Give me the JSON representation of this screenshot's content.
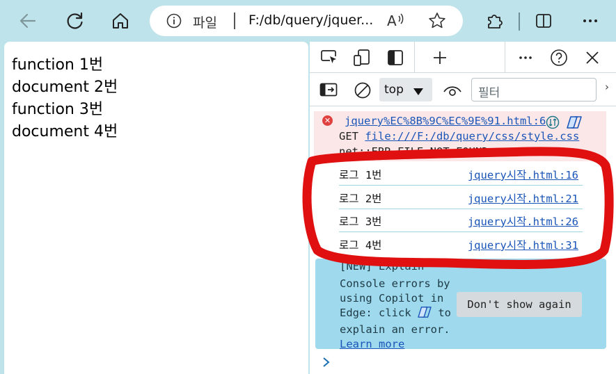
{
  "browser": {
    "site_label": "파일",
    "url": "F:/db/query/jquer...",
    "read_aloud_label": "A"
  },
  "page": {
    "lines": [
      "function 1번",
      "document 2번",
      "function 3번",
      "document 4번"
    ]
  },
  "devtools": {
    "context": "top",
    "filter_placeholder": "필터",
    "error": {
      "source": "jquery%EC%8B%9C%EC%9E%91.html:6",
      "get_prefix": "GET ",
      "get_url": "file:///F:/db/query/css/style.css",
      "code": "net::ERR_FILE_NOT_FOUND"
    },
    "logs": [
      {
        "message": "로그 1번",
        "source": "jquery시작.html:16"
      },
      {
        "message": "로그 2번",
        "source": "jquery시작.html:21"
      },
      {
        "message": "로그 3번",
        "source": "jquery시작.html:26"
      },
      {
        "message": "로그 4번",
        "source": "jquery시작.html:31"
      }
    ],
    "tip": {
      "header": "[NEW] Explain",
      "line1": "Console errors by",
      "line2": "using Copilot in",
      "line3a": "Edge: click",
      "line3b": "to",
      "line4": "explain an error.",
      "learn_more": "Learn more",
      "dismiss": "Don't show again"
    },
    "prompt_symbol": "›"
  },
  "colors": {
    "chrome_bg": "#bfe3ea",
    "error_bg": "#fbe7e7",
    "tip_bg": "#9fd9ee",
    "link": "#1a55b8",
    "annotation": "#e01010"
  }
}
